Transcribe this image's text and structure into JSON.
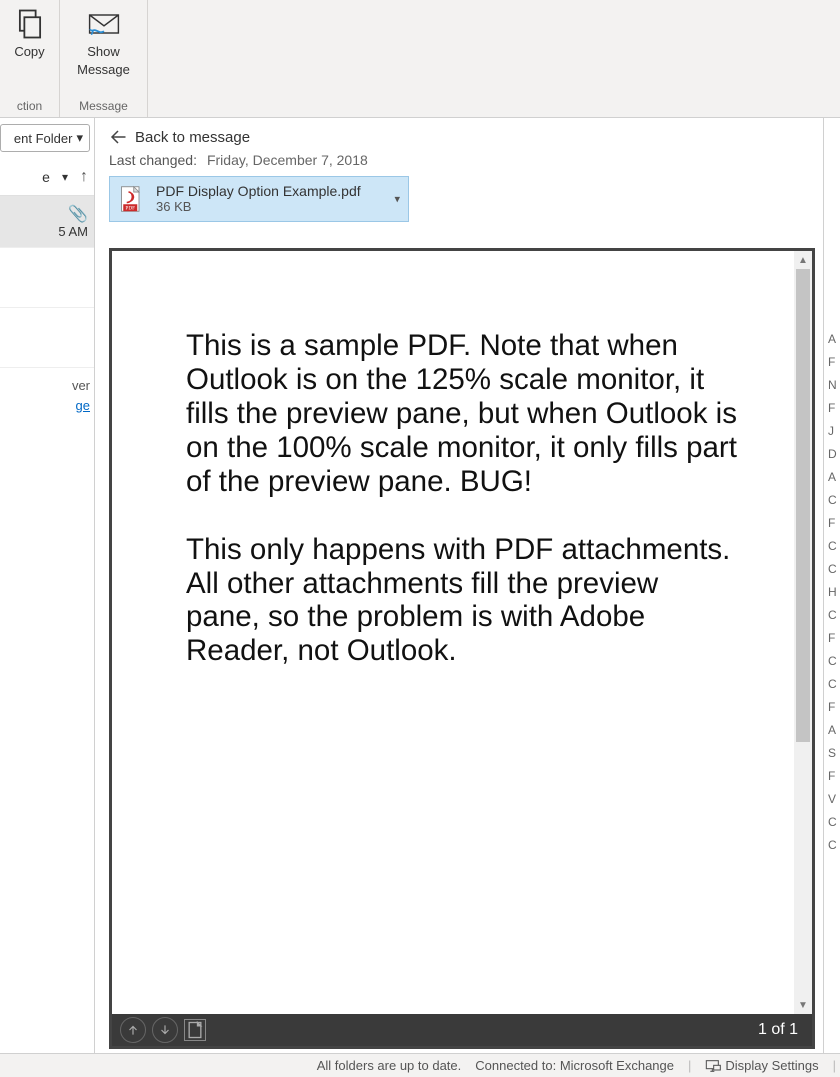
{
  "ribbon": {
    "copy_label": "Copy",
    "showmsg_label1": "Show",
    "showmsg_label2": "Message",
    "group_left": "ction",
    "group_right": "Message"
  },
  "list": {
    "folder_dropdown": "ent Folder",
    "sort_label": "e",
    "item_time": "5 AM",
    "group_label": "ver",
    "show_msg_link": "ge"
  },
  "preview": {
    "back_label": "Back to message",
    "lastchanged_label": "Last changed:",
    "lastchanged_value": "Friday, December 7, 2018",
    "attachment": {
      "filename": "PDF Display Option Example.pdf",
      "filesize": "36 KB"
    },
    "pdf_para1": "This is a sample PDF. Note that when Outlook is on the 125% scale monitor, it fills the preview pane, but when Outlook is on the 100% scale monitor, it only fills part of the preview pane. BUG!",
    "pdf_para2": "This only happens with PDF attachments. All other attachments fill the preview pane, so the problem is with Adobe Reader, not Outlook.",
    "page_indicator": "1 of 1"
  },
  "right": {
    "letters": [
      "A",
      "",
      "F",
      "N",
      "",
      "F",
      "J",
      "D",
      "A",
      "C",
      "F",
      "C",
      "C",
      "H",
      "C",
      "F",
      "C",
      "C",
      "F",
      "A",
      "S",
      "F",
      "V",
      "C",
      "C"
    ]
  },
  "statusbar": {
    "folders": "All folders are up to date.",
    "connected": "Connected to: Microsoft Exchange",
    "display_settings": "Display Settings"
  }
}
